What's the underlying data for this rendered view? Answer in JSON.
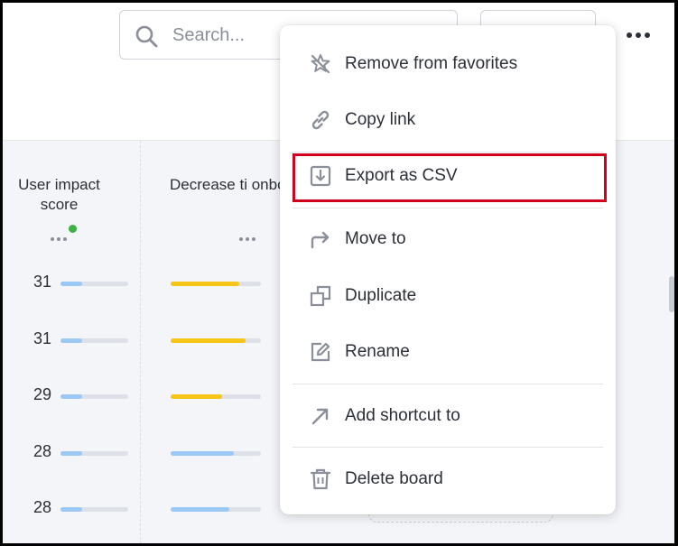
{
  "header": {
    "search_placeholder": "Search..."
  },
  "board": {
    "columns": [
      {
        "title": "User impact score"
      },
      {
        "title": "Decrease ti onboarding ou"
      }
    ],
    "rows": [
      {
        "score": "31",
        "impact_fill": 0.32,
        "decrease_fill": 0.76,
        "decrease_color": "#f5c518"
      },
      {
        "score": "31",
        "impact_fill": 0.32,
        "decrease_fill": 0.83,
        "decrease_color": "#f5c518"
      },
      {
        "score": "29",
        "impact_fill": 0.32,
        "decrease_fill": 0.57,
        "decrease_color": "#f5c518"
      },
      {
        "score": "28",
        "impact_fill": 0.32,
        "decrease_fill": 0.7,
        "decrease_color": "#9cc8f5"
      },
      {
        "score": "28",
        "impact_fill": 0.32,
        "decrease_fill": 0.65,
        "decrease_color": "#9cc8f5"
      }
    ],
    "impact_color": "#9cc8f5",
    "status_dot_color": "#3cb043"
  },
  "menu": {
    "items": [
      {
        "label": "Remove from favorites",
        "icon": "star-off-icon"
      },
      {
        "label": "Copy link",
        "icon": "link-icon"
      },
      {
        "label": "Export as CSV",
        "icon": "export-icon"
      },
      {
        "label": "Move to",
        "icon": "move-arrow-icon"
      },
      {
        "label": "Duplicate",
        "icon": "duplicate-icon"
      },
      {
        "label": "Rename",
        "icon": "rename-icon"
      },
      {
        "label": "Add shortcut to",
        "icon": "shortcut-arrow-icon"
      },
      {
        "label": "Delete board",
        "icon": "trash-icon"
      }
    ],
    "highlight_color": "#d0021b"
  }
}
